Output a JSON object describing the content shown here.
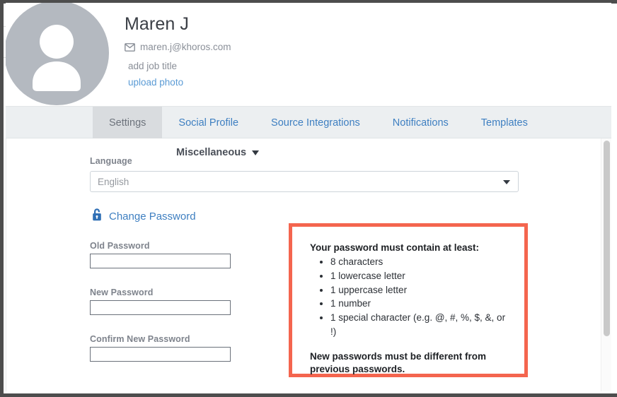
{
  "profile": {
    "name": "Maren J",
    "email": "maren.j@khoros.com",
    "email_icon": "envelope-icon",
    "job_title_placeholder": "add job title",
    "upload_photo_label": "upload photo",
    "avatar_icon": "user-avatar-icon"
  },
  "tabs": [
    {
      "label": "Settings",
      "active": true
    },
    {
      "label": "Social Profile",
      "active": false
    },
    {
      "label": "Source Integrations",
      "active": false
    },
    {
      "label": "Notifications",
      "active": false
    },
    {
      "label": "Templates",
      "active": false
    }
  ],
  "settings": {
    "section_header": "Miscellaneous",
    "section_caret_icon": "chevron-down-icon",
    "language_label": "Language",
    "language_value": "English",
    "language_caret_icon": "chevron-down-icon",
    "change_password_label": "Change Password",
    "change_password_icon": "lock-icon",
    "old_password_label": "Old Password",
    "old_password_value": "",
    "new_password_label": "New Password",
    "new_password_value": "",
    "confirm_password_label": "Confirm New Password",
    "confirm_password_value": ""
  },
  "password_requirements": {
    "title": "Your password must contain at least:",
    "items": [
      "8 characters",
      "1 lowercase letter",
      "1 uppercase letter",
      "1 number",
      "1 special character (e.g. @, #, %, $, &, or !)"
    ],
    "footer": "New passwords must be different from previous passwords."
  },
  "colors": {
    "link_blue": "#3e7fc1",
    "callout_red": "#f4654e",
    "tabbar_bg": "#eceff1",
    "active_tab_bg": "#d9dcdf",
    "avatar_gray": "#b4b9c0",
    "frame_gray": "#4d4d4d"
  }
}
